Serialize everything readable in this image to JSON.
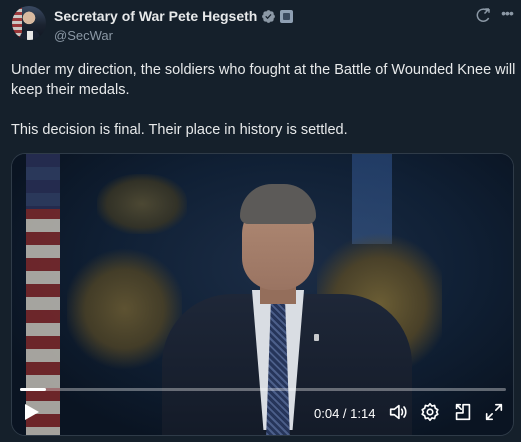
{
  "author": {
    "display_name": "Secretary of War Pete Hegseth",
    "handle": "@SecWar"
  },
  "post": {
    "line1": "Under my direction, the soldiers who fought at the Battle of Wounded Knee will keep their medals.",
    "line2": "This decision is final. Their place in history is settled."
  },
  "video": {
    "current_time": "0:04",
    "separator": " / ",
    "duration": "1:14",
    "progress_fraction": 0.054
  },
  "icons": {
    "verified": "verified-badge-icon",
    "affiliation": "affiliation-badge-icon",
    "grok": "grok-icon",
    "more": "more-icon",
    "play": "play-icon",
    "volume": "volume-icon",
    "settings": "settings-icon",
    "pip": "picture-in-picture-icon",
    "fullscreen": "fullscreen-icon"
  },
  "colors": {
    "background": "#15202b",
    "text": "#e7e9ea",
    "muted": "#8b98a5",
    "verified": "#8b98a5"
  }
}
